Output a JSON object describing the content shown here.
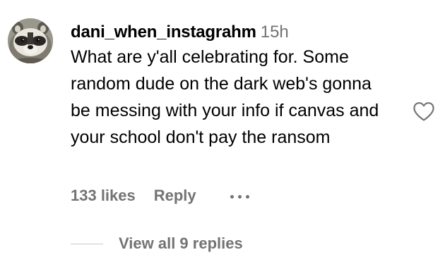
{
  "comment": {
    "username": "dani_when_instagrahm",
    "timestamp": "15h",
    "text": "What are y'all celebrating for. Some random dude on the dark web's gonna be messing with your info if canvas and your school don't pay the ransom",
    "likes": "133 likes",
    "reply_label": "Reply",
    "more_icon": "more-options-icon",
    "heart_icon": "heart-outline-icon",
    "avatar_icon": "raccoon-avatar"
  },
  "replies": {
    "label": "View all 9 replies"
  },
  "colors": {
    "text": "#000000",
    "secondary": "#737373",
    "divider": "#c7c7c7",
    "background": "#ffffff"
  }
}
